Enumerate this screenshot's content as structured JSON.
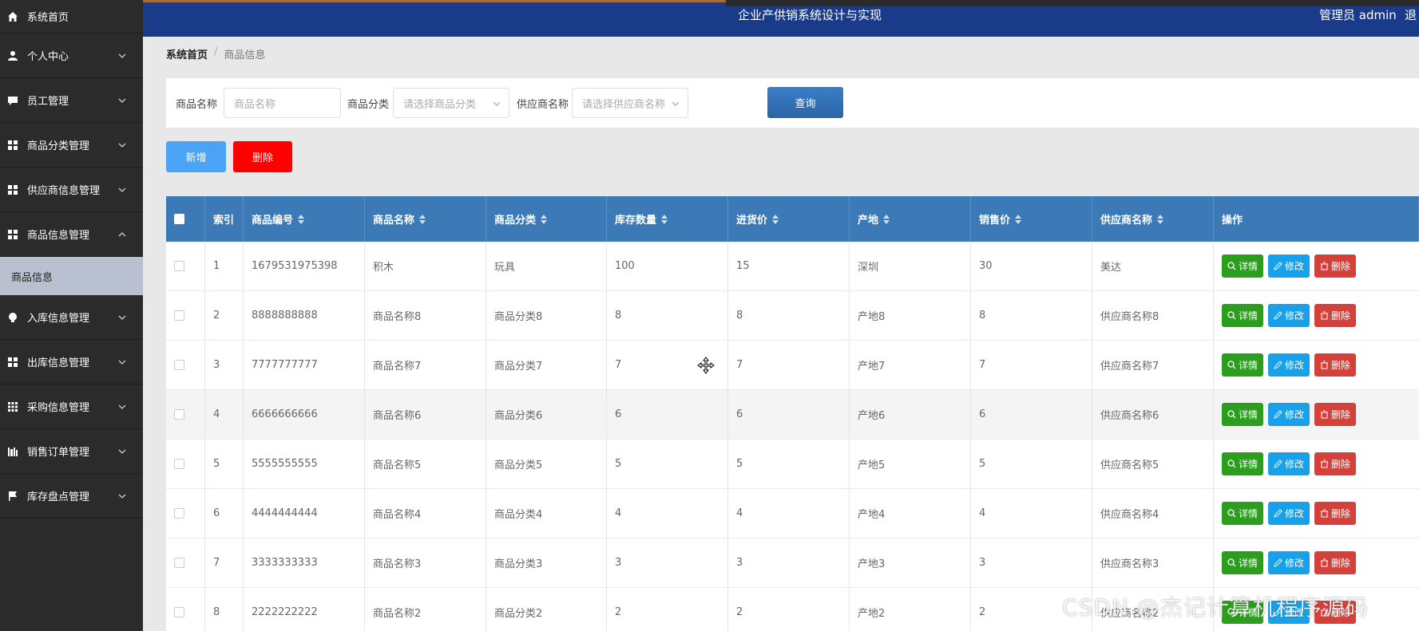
{
  "header": {
    "title": "企业产供销系统设计与实现",
    "admin": "管理员 admin",
    "logout": "退"
  },
  "sidebar": {
    "home": "系统首页",
    "items": [
      {
        "label": "个人中心",
        "icon": "user-icon"
      },
      {
        "label": "员工管理",
        "icon": "chat-icon"
      },
      {
        "label": "商品分类管理",
        "icon": "grid-icon"
      },
      {
        "label": "供应商信息管理",
        "icon": "grid-icon"
      },
      {
        "label": "商品信息管理",
        "icon": "grid-icon",
        "expanded": true
      },
      {
        "label": "入库信息管理",
        "icon": "bulb-icon"
      },
      {
        "label": "出库信息管理",
        "icon": "grid-icon"
      },
      {
        "label": "采购信息管理",
        "icon": "apps-icon"
      },
      {
        "label": "销售订单管理",
        "icon": "bars-icon"
      },
      {
        "label": "库存盘点管理",
        "icon": "flag-icon"
      }
    ],
    "sub_item": "商品信息"
  },
  "breadcrumb": {
    "home": "系统首页",
    "sep": "/",
    "current": "商品信息"
  },
  "search": {
    "name_label": "商品名称",
    "name_placeholder": "商品名称",
    "category_label": "商品分类",
    "category_placeholder": "请选择商品分类",
    "supplier_label": "供应商名称",
    "supplier_placeholder": "请选择供应商名称",
    "query_button": "查询"
  },
  "toolbar": {
    "add": "新增",
    "delete": "删除"
  },
  "table": {
    "headers": [
      "索引",
      "商品编号",
      "商品名称",
      "商品分类",
      "库存数量",
      "进货价",
      "产地",
      "销售价",
      "供应商名称",
      "操作"
    ],
    "ops": {
      "detail": "详情",
      "edit": "修改",
      "delete": "删除"
    },
    "rows": [
      [
        "1",
        "1679531975398",
        "积木",
        "玩具",
        "100",
        "15",
        "深圳",
        "30",
        "美达"
      ],
      [
        "2",
        "8888888888",
        "商品名称8",
        "商品分类8",
        "8",
        "8",
        "产地8",
        "8",
        "供应商名称8"
      ],
      [
        "3",
        "7777777777",
        "商品名称7",
        "商品分类7",
        "7",
        "7",
        "产地7",
        "7",
        "供应商名称7"
      ],
      [
        "4",
        "6666666666",
        "商品名称6",
        "商品分类6",
        "6",
        "6",
        "产地6",
        "6",
        "供应商名称6"
      ],
      [
        "5",
        "5555555555",
        "商品名称5",
        "商品分类5",
        "5",
        "5",
        "产地5",
        "5",
        "供应商名称5"
      ],
      [
        "6",
        "4444444444",
        "商品名称4",
        "商品分类4",
        "4",
        "4",
        "产地4",
        "4",
        "供应商名称4"
      ],
      [
        "7",
        "3333333333",
        "商品名称3",
        "商品分类3",
        "3",
        "3",
        "产地3",
        "3",
        "供应商名称3"
      ],
      [
        "8",
        "2222222222",
        "商品名称2",
        "商品分类2",
        "2",
        "2",
        "产地2",
        "2",
        "供应商名称2"
      ]
    ]
  },
  "watermark": "CSDN @杰记计算机程序源码"
}
